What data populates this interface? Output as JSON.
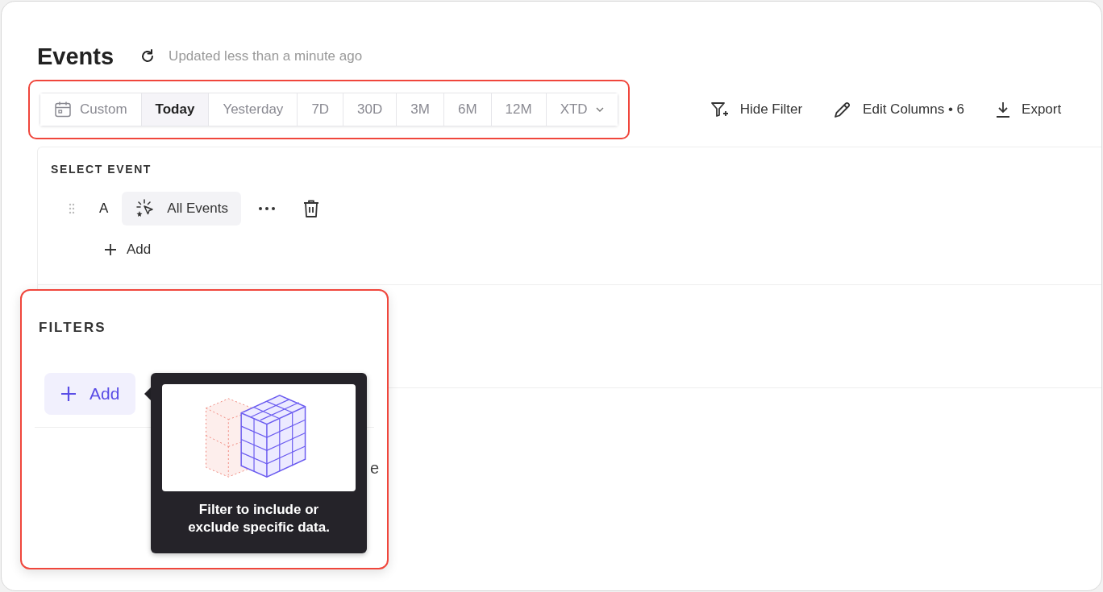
{
  "header": {
    "title": "Events",
    "status": "Updated less than a minute ago"
  },
  "date_range": {
    "highlighted": true,
    "options": [
      {
        "label": "Custom",
        "kind": "custom",
        "selected": false
      },
      {
        "label": "Today",
        "kind": "preset",
        "selected": true
      },
      {
        "label": "Yesterday",
        "kind": "preset",
        "selected": false
      },
      {
        "label": "7D",
        "kind": "preset",
        "selected": false
      },
      {
        "label": "30D",
        "kind": "preset",
        "selected": false
      },
      {
        "label": "3M",
        "kind": "preset",
        "selected": false
      },
      {
        "label": "6M",
        "kind": "preset",
        "selected": false
      },
      {
        "label": "12M",
        "kind": "preset",
        "selected": false
      },
      {
        "label": "XTD",
        "kind": "dropdown",
        "selected": false
      }
    ]
  },
  "actions": [
    {
      "label": "Hide Filter",
      "kind": "filter"
    },
    {
      "label": "Edit Columns • 6",
      "kind": "edit"
    },
    {
      "label": "Export",
      "kind": "export"
    }
  ],
  "select_event": {
    "heading": "SELECT EVENT",
    "events": [
      {
        "letter": "A",
        "name": "All Events"
      }
    ],
    "add_label": "Add"
  },
  "filters": {
    "highlighted": true,
    "heading": "FILTERS",
    "add_label": "Add",
    "hidden_text": "e",
    "tooltip": {
      "text": "Filter to include or exclude specific data."
    }
  }
}
